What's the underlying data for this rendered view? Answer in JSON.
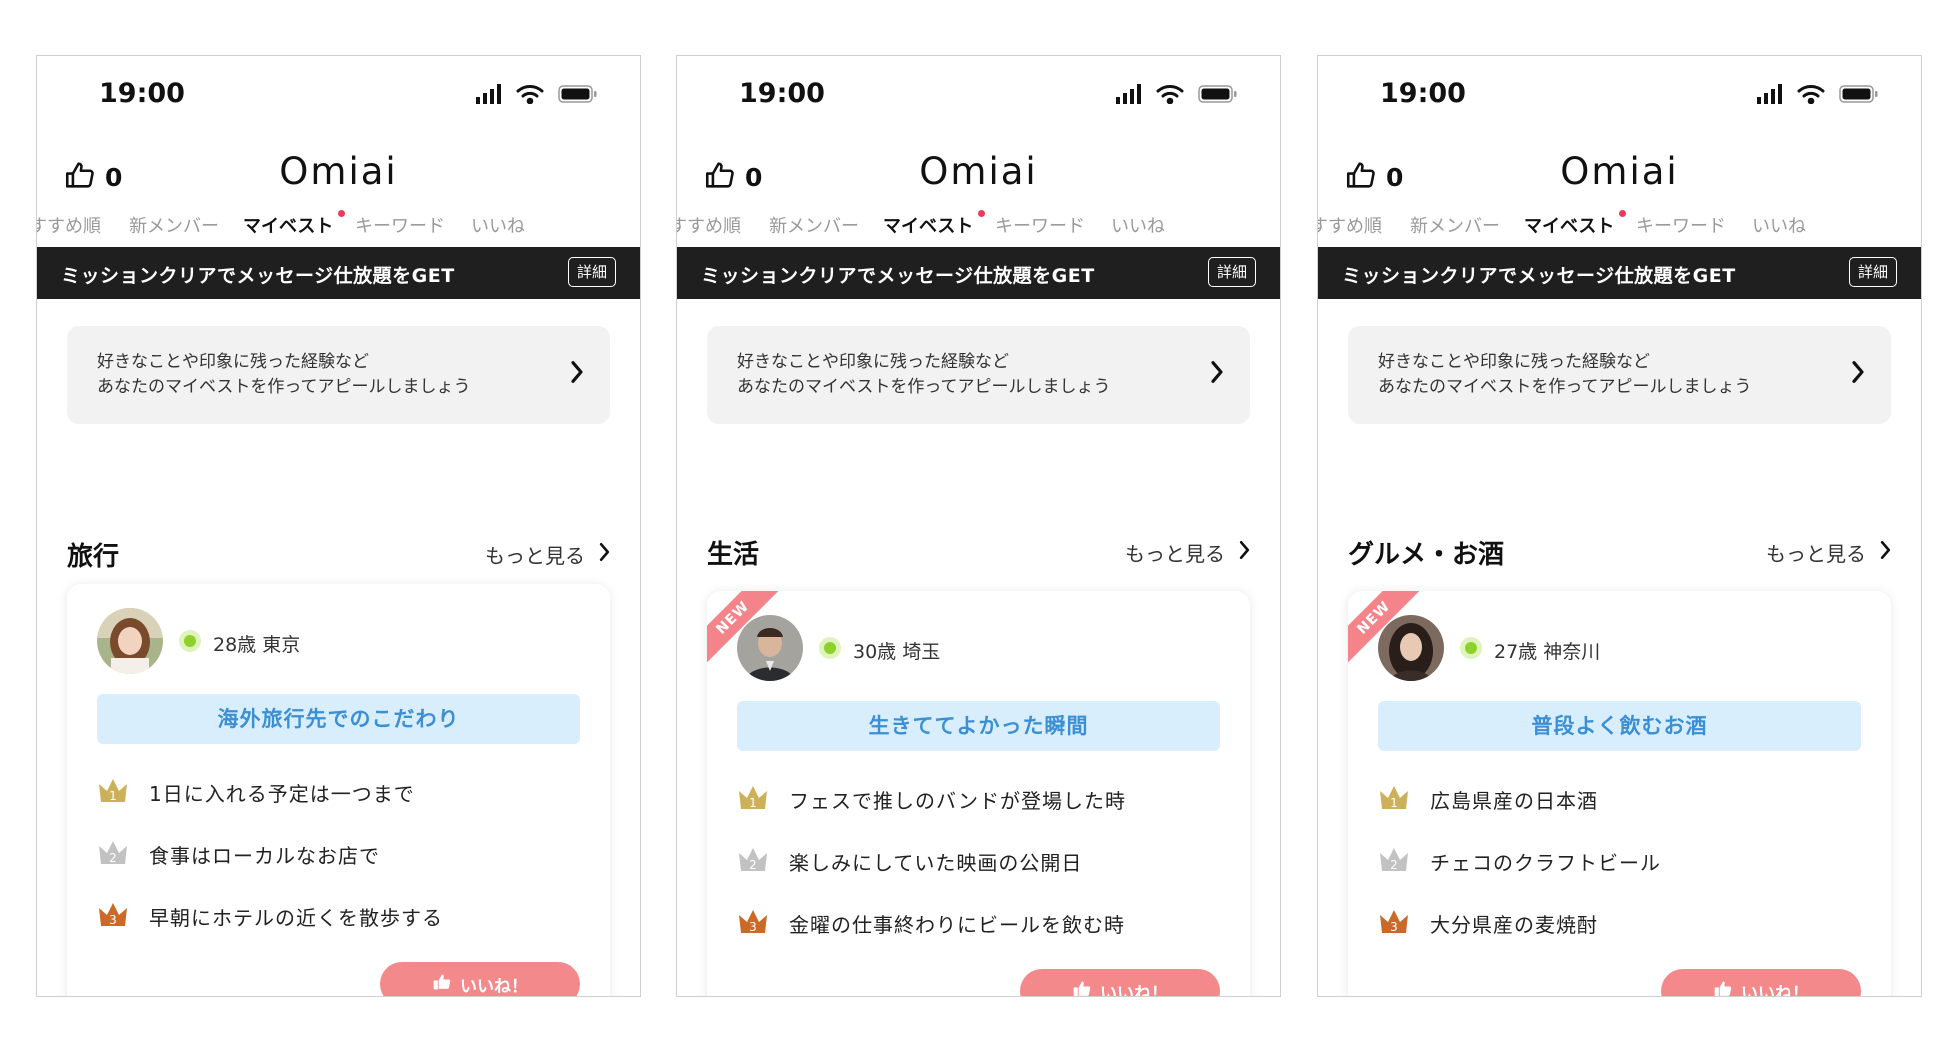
{
  "screens": [
    {
      "status": {
        "time": "19:00"
      },
      "header": {
        "like_count": "0",
        "logo": "Omiai"
      },
      "tabs": [
        "すすめ順",
        "新メンバー",
        "マイベスト",
        "キーワード",
        "いいね"
      ],
      "active_tab": "マイベスト",
      "banner": {
        "text": "ミッションクリアでメッセージ仕放題をGET",
        "button": "詳細"
      },
      "info": {
        "text": "好きなことや印象に残った経験など\nあなたのマイベストを作ってアピールしましょう"
      },
      "section": {
        "title": "旅行",
        "more": "もっと見る"
      },
      "card": {
        "is_new": false,
        "new_label": "",
        "online": true,
        "profile": "28歳 東京",
        "topic": "海外旅行先でのこだわり",
        "ranks": [
          {
            "num": "1",
            "text": "1日に入れる予定は一つまで"
          },
          {
            "num": "2",
            "text": "食事はローカルなお店で"
          },
          {
            "num": "3",
            "text": "早朝にホテルの近くを散歩する"
          }
        ],
        "like_button": "いいね！"
      }
    },
    {
      "status": {
        "time": "19:00"
      },
      "header": {
        "like_count": "0",
        "logo": "Omiai"
      },
      "tabs": [
        "すすめ順",
        "新メンバー",
        "マイベスト",
        "キーワード",
        "いいね"
      ],
      "active_tab": "マイベスト",
      "banner": {
        "text": "ミッションクリアでメッセージ仕放題をGET",
        "button": "詳細"
      },
      "info": {
        "text": "好きなことや印象に残った経験など\nあなたのマイベストを作ってアピールしましょう"
      },
      "section": {
        "title": "生活",
        "more": "もっと見る"
      },
      "card": {
        "is_new": true,
        "new_label": "NEW",
        "online": true,
        "profile": "30歳 埼玉",
        "topic": "生きててよかった瞬間",
        "ranks": [
          {
            "num": "1",
            "text": "フェスで推しのバンドが登場した時"
          },
          {
            "num": "2",
            "text": "楽しみにしていた映画の公開日"
          },
          {
            "num": "3",
            "text": "金曜の仕事終わりにビールを飲む時"
          }
        ],
        "like_button": "いいね！"
      }
    },
    {
      "status": {
        "time": "19:00"
      },
      "header": {
        "like_count": "0",
        "logo": "Omiai"
      },
      "tabs": [
        "すすめ順",
        "新メンバー",
        "マイベスト",
        "キーワード",
        "いいね"
      ],
      "active_tab": "マイベスト",
      "banner": {
        "text": "ミッションクリアでメッセージ仕放題をGET",
        "button": "詳細"
      },
      "info": {
        "text": "好きなことや印象に残った経験など\nあなたのマイベストを作ってアピールしましょう"
      },
      "section": {
        "title": "グルメ・お酒",
        "more": "もっと見る"
      },
      "card": {
        "is_new": true,
        "new_label": "NEW",
        "online": true,
        "profile": "27歳 神奈川",
        "topic": "普段よく飲むお酒",
        "ranks": [
          {
            "num": "1",
            "text": "広島県産の日本酒"
          },
          {
            "num": "2",
            "text": "チェコのクラフトビール"
          },
          {
            "num": "3",
            "text": "大分県産の麦焼酎"
          }
        ],
        "like_button": "いいね！"
      }
    }
  ],
  "colors": {
    "banner_bg": "#1f1f1f",
    "topic_bg": "#d8eefd",
    "topic_text": "#3d8fd4",
    "like_button": "#f4898c",
    "online": "#8fd12b",
    "rank1": "#cdb05a",
    "rank2": "#c2c2c2",
    "rank3": "#c96a2a",
    "new_ribbon": "#f4848a",
    "tab_dot": "#ee3a5a"
  },
  "icons": [
    "thumbs-up-icon",
    "signal-icon",
    "wifi-icon",
    "battery-icon",
    "chevron-right-icon",
    "crown-icon",
    "online-indicator-icon"
  ]
}
